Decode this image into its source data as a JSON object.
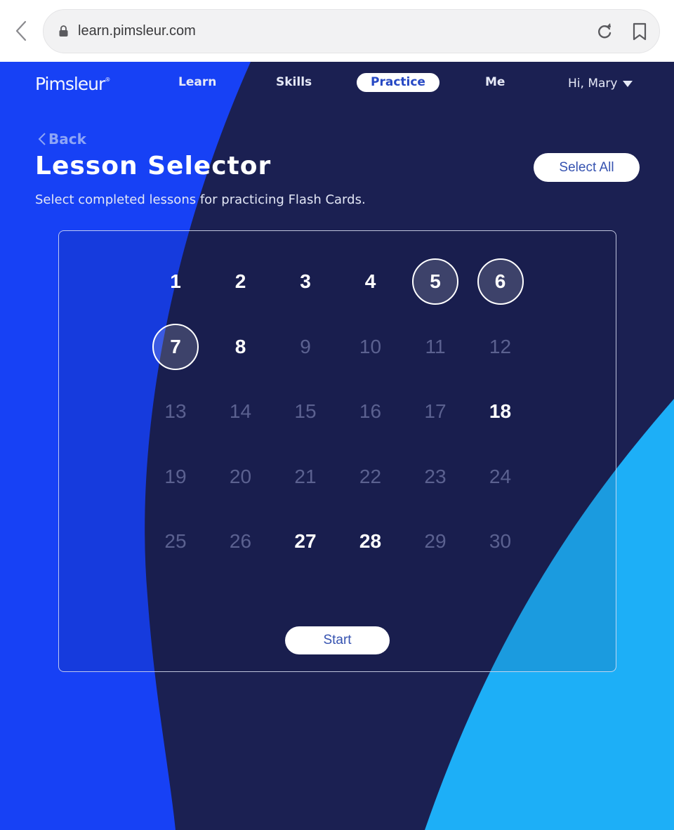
{
  "browser": {
    "url": "learn.pimsleur.com",
    "icons": {
      "back": "chevron-left-icon",
      "lock": "lock-icon",
      "reload": "reload-icon",
      "bookmark": "bookmark-icon"
    }
  },
  "nav": {
    "logo": "Pimsleur",
    "logo_mark": "®",
    "items": [
      {
        "label": "Learn",
        "active": false
      },
      {
        "label": "Skills",
        "active": false
      },
      {
        "label": "Practice",
        "active": true
      },
      {
        "label": "Me",
        "active": false
      }
    ],
    "user_greeting": "Hi, Mary",
    "user_menu_icon": "caret-down-icon"
  },
  "header": {
    "back_label": "Back",
    "title": "Lesson Selector",
    "subtitle": "Select completed lessons for practicing Flash Cards.",
    "select_all_label": "Select All"
  },
  "lessons": [
    {
      "number": "1",
      "state": "completed"
    },
    {
      "number": "2",
      "state": "completed"
    },
    {
      "number": "3",
      "state": "completed"
    },
    {
      "number": "4",
      "state": "completed"
    },
    {
      "number": "5",
      "state": "selected"
    },
    {
      "number": "6",
      "state": "selected"
    },
    {
      "number": "7",
      "state": "selected"
    },
    {
      "number": "8",
      "state": "completed"
    },
    {
      "number": "9",
      "state": "locked"
    },
    {
      "number": "10",
      "state": "locked"
    },
    {
      "number": "11",
      "state": "locked"
    },
    {
      "number": "12",
      "state": "locked"
    },
    {
      "number": "13",
      "state": "locked"
    },
    {
      "number": "14",
      "state": "locked"
    },
    {
      "number": "15",
      "state": "locked"
    },
    {
      "number": "16",
      "state": "locked"
    },
    {
      "number": "17",
      "state": "locked"
    },
    {
      "number": "18",
      "state": "completed"
    },
    {
      "number": "19",
      "state": "locked"
    },
    {
      "number": "20",
      "state": "locked"
    },
    {
      "number": "21",
      "state": "locked"
    },
    {
      "number": "22",
      "state": "locked"
    },
    {
      "number": "23",
      "state": "locked"
    },
    {
      "number": "24",
      "state": "locked"
    },
    {
      "number": "25",
      "state": "locked"
    },
    {
      "number": "26",
      "state": "locked"
    },
    {
      "number": "27",
      "state": "completed"
    },
    {
      "number": "28",
      "state": "completed"
    },
    {
      "number": "29",
      "state": "locked"
    },
    {
      "number": "30",
      "state": "locked"
    }
  ],
  "start_label": "Start",
  "colors": {
    "brand_blue": "#1741f5",
    "navy": "#1b2052",
    "sky": "#1daff7",
    "button_text": "#3552b0"
  }
}
